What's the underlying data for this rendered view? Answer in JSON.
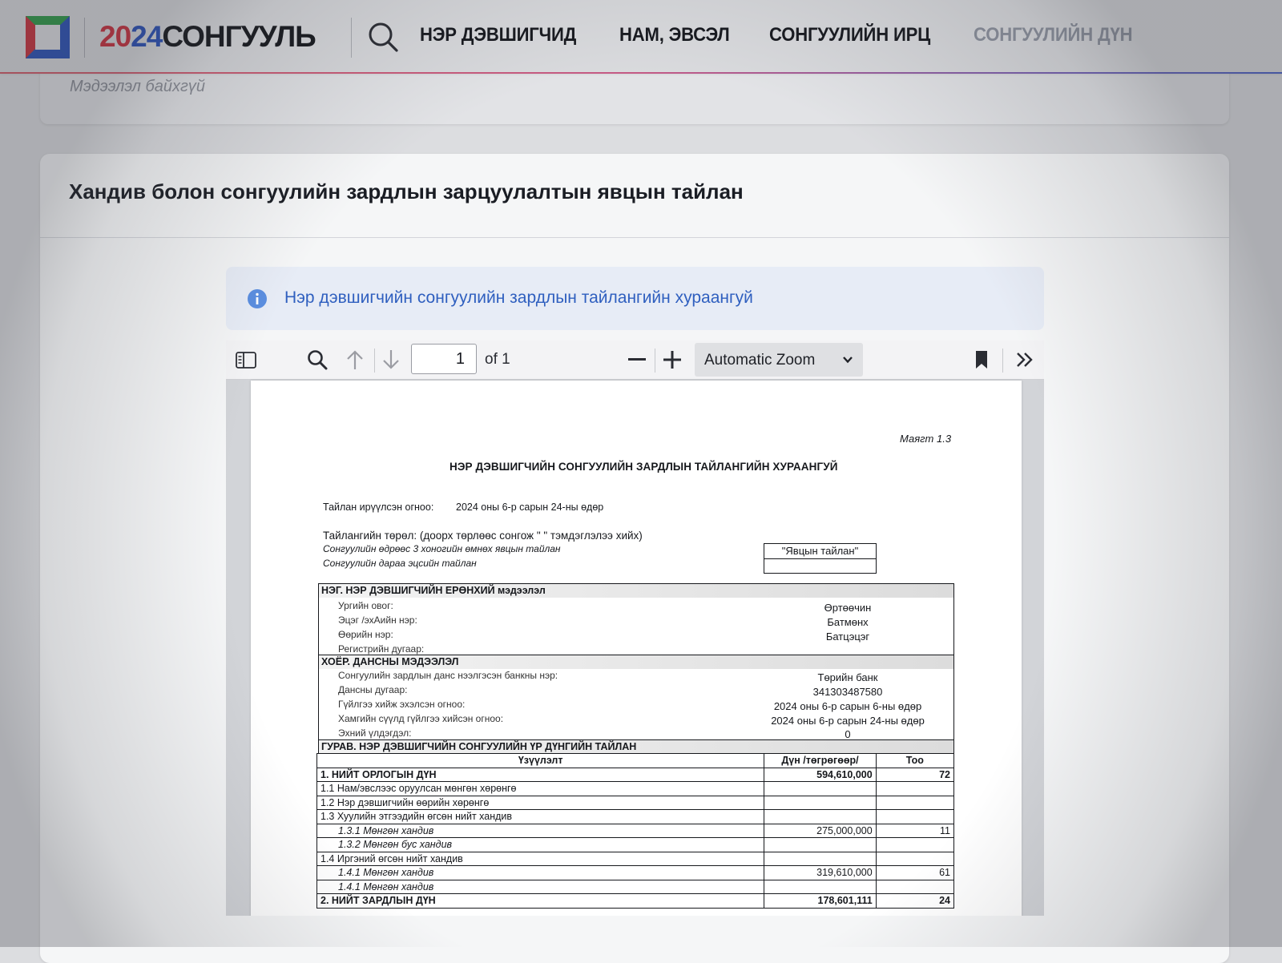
{
  "header": {
    "brand": {
      "y1": "20",
      "y2": "2",
      "y3": "4",
      "name": "СОНГУУЛЬ"
    },
    "nav": [
      {
        "label": "НЭР ДЭВШИГЧИД"
      },
      {
        "label": "НАМ, ЭВСЭЛ"
      },
      {
        "label": "СОНГУУЛИЙН ИРЦ"
      },
      {
        "label": "СОНГУУЛИЙН ДҮН"
      }
    ],
    "icons": {
      "logo": "square-logo-icon",
      "search": "search-icon"
    }
  },
  "previous_card": {
    "empty_text": "Мэдээлэл байхгүй"
  },
  "report_card": {
    "title": "Хандив болон сонгуулийн зардлын зарцуулалтын явцын тайлан",
    "alert": {
      "icon": "info-icon",
      "text": "Нэр дэвшигчийн сонгуулийн зардлын тайлангийн хураангуй"
    }
  },
  "pdf_viewer": {
    "toolbar": {
      "sidebar_icon": "sidebar-toggle-icon",
      "find_icon": "search-icon",
      "prev_icon": "arrow-up-icon",
      "next_icon": "arrow-down-icon",
      "page_value": "1",
      "page_count_label": "of 1",
      "zoom_out_icon": "minus-icon",
      "zoom_in_icon": "plus-icon",
      "zoom_label": "Automatic Zoom",
      "bookmark_icon": "bookmark-icon",
      "more_icon": "double-chevron-right-icon"
    },
    "document": {
      "annex": "Маягт 1.3",
      "title": "НЭР ДЭВШИГЧИЙН СОНГУУЛИЙН ЗАРДЛЫН ТАЙЛАНГИЙН ХУРААНГУЙ",
      "date_label": "Тайлан ирүүлсэн огноо:",
      "date_value": "2024 оны 6-р сарын 24-ны өдөр",
      "type_label": "Тайлангийн төрөл: (доорх төрлөөс сонгож \"  \" тэмдэглэлээ хийх)",
      "type_option_1": "Сонгуулийн өдрөөс 3 хоногийн өмнөх явцын тайлан",
      "type_option_2": "Сонгуулийн дараа эцсийн тайлан",
      "type_selected": "\"Явцын тайлан\"",
      "section1": {
        "heading": "НЭГ. НЭР ДЭВШИГЧИЙН ЕРӨНХИЙ мэдээлэл",
        "rows": [
          {
            "label": "Ургийн овог:",
            "value": "Өртөөчин"
          },
          {
            "label": "Эцэг /эхАийн нэр:",
            "value": "Батмөнх"
          },
          {
            "label": "Өөрийн нэр:",
            "value": "Батцэцэг"
          },
          {
            "label": "Регистрийн дугаар:",
            "value": ""
          }
        ]
      },
      "section2": {
        "heading": "ХОЁР. ДАНСНЫ МЭДЭЭЛЭЛ",
        "rows": [
          {
            "label": "Сонгуулийн зардлын данс нээлгэсэн банкны нэр:",
            "value": "Төрийн банк"
          },
          {
            "label": "Дансны дугаар:",
            "value": "341303487580"
          },
          {
            "label": "Гүйлгээ хийж эхэлсэн огноо:",
            "value": "2024 оны 6-р сарын 6-ны өдөр"
          },
          {
            "label": "Хамгийн сүүлд гүйлгээ хийсэн огноо:",
            "value": "2024 оны 6-р сарын 24-ны өдөр"
          },
          {
            "label": "Эхний үлдэгдэл:",
            "value": "0"
          }
        ]
      },
      "section3": {
        "heading": "ГУРАВ. НЭР ДЭВШИГЧИЙН СОНГУУЛИЙН ҮР ДҮНГИЙН ТАЙЛАН",
        "columns": [
          "Үзүүлэлт",
          "Дүн /төгрөгөөр/",
          "Тоо"
        ],
        "rows": [
          {
            "label": "1. НИЙТ ОРЛОГЫН ДҮН",
            "amount": "594,610,000",
            "count": "72"
          },
          {
            "label": "1.1 Нам/эвслээс оруулсан мөнгөн хөрөнгө",
            "amount": "",
            "count": ""
          },
          {
            "label": "1.2 Нэр дэвшигчийн өөрийн хөрөнгө",
            "amount": "",
            "count": ""
          },
          {
            "label": "1.3 Хуулийн этгээдийн өгсөн нийт хандив",
            "amount": "",
            "count": ""
          },
          {
            "label": "1.3.1 Мөнгөн хандив",
            "amount": "275,000,000",
            "count": "11"
          },
          {
            "label": "1.3.2 Мөнгөн бус хандив",
            "amount": "",
            "count": ""
          },
          {
            "label": "1.4 Иргэний өгсөн нийт хандив",
            "amount": "",
            "count": ""
          },
          {
            "label": "1.4.1 Мөнгөн хандив",
            "amount": "319,610,000",
            "count": "61"
          },
          {
            "label": "1.4.1 Мөнгөн хандив",
            "amount": "",
            "count": ""
          },
          {
            "label": "2. НИЙТ ЗАРДЛЫН ДҮН",
            "amount": "178,601,111",
            "count": "24"
          }
        ]
      }
    }
  }
}
